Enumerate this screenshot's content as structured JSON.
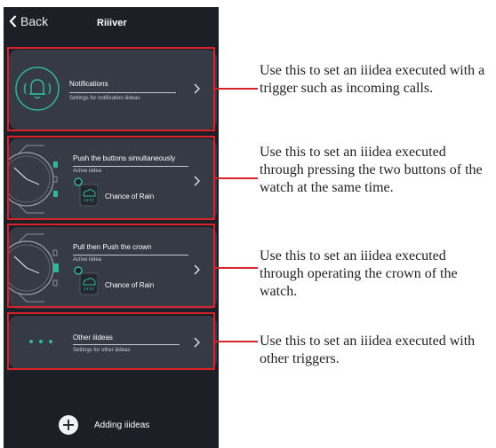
{
  "header": {
    "back_label": "Back",
    "title": "Riiiver"
  },
  "cards": [
    {
      "title": "Notifications",
      "subtitle": "Settings for notification iiideas"
    },
    {
      "title": "Push the buttons simultaneously",
      "subtitle": "Active iiidea",
      "iiidea": "Chance of Rain"
    },
    {
      "title": "Pull then Push the crown",
      "subtitle": "Active iiidea",
      "iiidea": "Chance of Rain"
    },
    {
      "title": "Other iiideas",
      "subtitle": "Settings for other iiideas"
    }
  ],
  "footer": {
    "add_label": "Adding iiideas"
  },
  "annotations": [
    "Use this to set an iiidea executed with a trigger such as incoming calls.",
    "Use this to set an iiidea executed through pressing the two buttons of the watch at the same time.",
    "Use this to set an iiidea executed through operating the crown of the watch.",
    "Use this to set an iiidea executed with other triggers."
  ],
  "colors": {
    "highlight": "#d8232a",
    "accent": "#2fb894",
    "card": "#353a45",
    "background": "#1c1f26"
  }
}
